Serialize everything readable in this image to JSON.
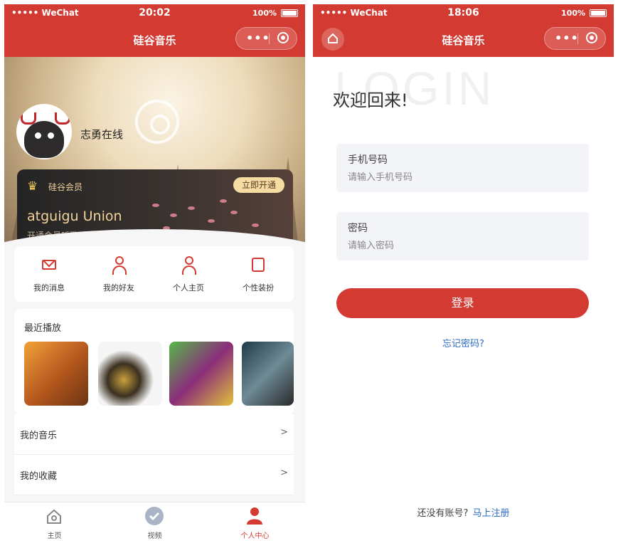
{
  "left": {
    "status": {
      "carrier": "••••• WeChat",
      "time": "20:02",
      "battery": "100%"
    },
    "nav_title": "硅谷音乐",
    "capsule": {
      "more_icon": "•••"
    },
    "profile": {
      "username": "志勇在线"
    },
    "vip": {
      "label": "硅谷会员",
      "button": "立即开通",
      "title": "atguigu Union",
      "subtitle": "开通会员听歌, 撸代码"
    },
    "menu": [
      {
        "label": "我的消息",
        "icon": "mail-icon"
      },
      {
        "label": "我的好友",
        "icon": "friends-icon"
      },
      {
        "label": "个人主页",
        "icon": "user-icon"
      },
      {
        "label": "个性装扮",
        "icon": "shirt-icon"
      }
    ],
    "recent": {
      "title": "最近播放"
    },
    "list": [
      {
        "label": "我的音乐",
        "arrow": ">"
      },
      {
        "label": "我的收藏",
        "arrow": ">"
      }
    ],
    "tabs": [
      {
        "label": "主页",
        "icon": "home-icon"
      },
      {
        "label": "视频",
        "icon": "video-icon"
      },
      {
        "label": "个人中心",
        "icon": "profile-icon"
      }
    ],
    "colors": {
      "brand": "#d33a31",
      "vip_gold": "#f2d39b"
    }
  },
  "right": {
    "status": {
      "carrier": "••••• WeChat",
      "time": "18:06",
      "battery": "100%"
    },
    "nav_title": "硅谷音乐",
    "capsule": {
      "more_icon": "•••"
    },
    "watermark": "LOGIN",
    "welcome": "欢迎回来!",
    "phone_field": {
      "label": "手机号码",
      "placeholder": "请输入手机号码"
    },
    "password_field": {
      "label": "密码",
      "placeholder": "请输入密码"
    },
    "login_button": "登录",
    "forgot": "忘记密码?",
    "register_prompt": "还没有账号?",
    "register_link": "马上注册",
    "colors": {
      "link": "#2b6cc4",
      "field_bg": "#f3f4f7"
    }
  }
}
